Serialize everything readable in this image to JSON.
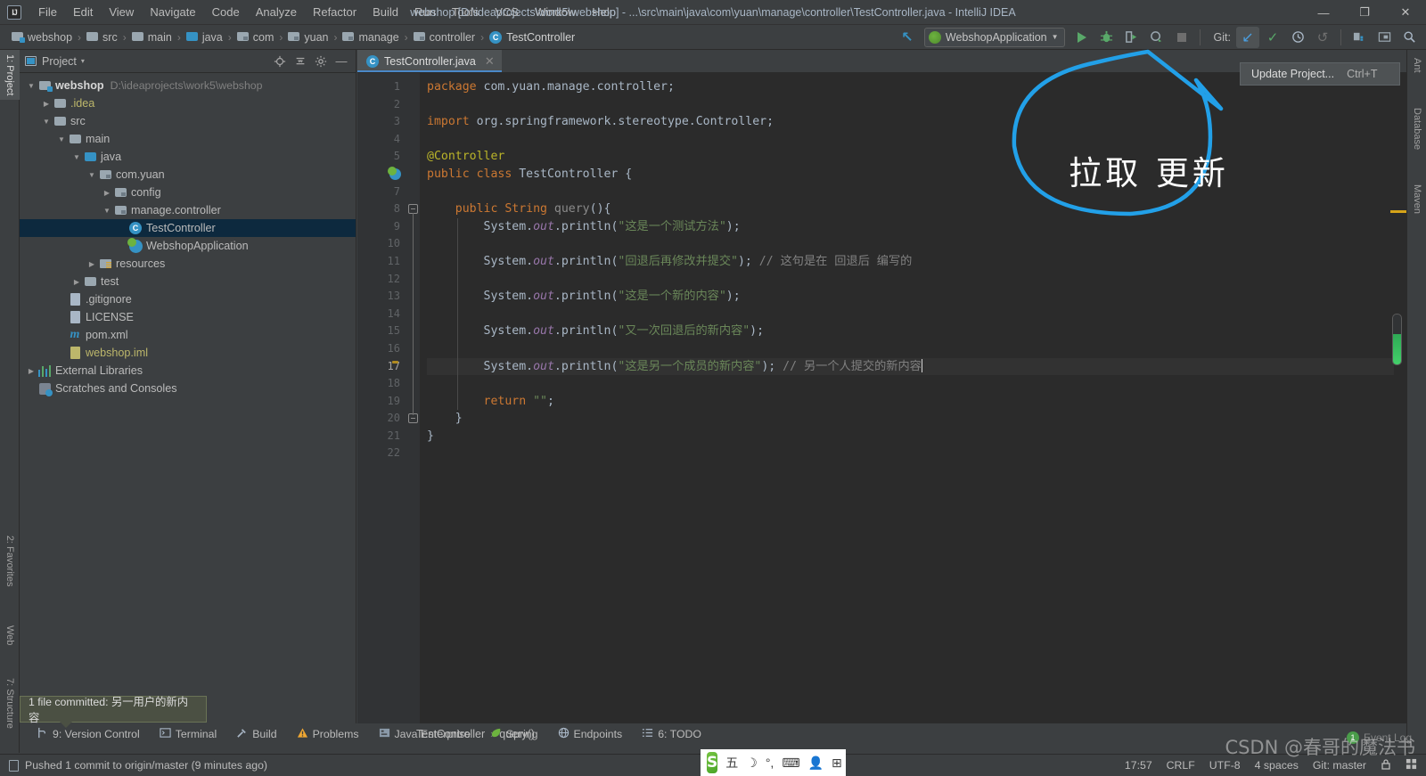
{
  "window": {
    "title": "webshop [D:\\ideaprojects\\work5\\webshop] - ...\\src\\main\\java\\com\\yuan\\manage\\controller\\TestController.java - IntelliJ IDEA",
    "minimize": "—",
    "maximize": "❐",
    "close": "✕"
  },
  "menu": [
    {
      "label": "File"
    },
    {
      "label": "Edit"
    },
    {
      "label": "View"
    },
    {
      "label": "Navigate"
    },
    {
      "label": "Code"
    },
    {
      "label": "Analyze"
    },
    {
      "label": "Refactor"
    },
    {
      "label": "Build"
    },
    {
      "label": "Run"
    },
    {
      "label": "Tools"
    },
    {
      "label": "VCS"
    },
    {
      "label": "Window"
    },
    {
      "label": "Help"
    }
  ],
  "breadcrumbs": [
    {
      "label": "webshop",
      "icon": "project-folder-icon"
    },
    {
      "label": "src",
      "icon": "folder-icon"
    },
    {
      "label": "main",
      "icon": "folder-icon"
    },
    {
      "label": "java",
      "icon": "source-folder-icon"
    },
    {
      "label": "com",
      "icon": "package-icon"
    },
    {
      "label": "yuan",
      "icon": "package-icon"
    },
    {
      "label": "manage",
      "icon": "package-icon"
    },
    {
      "label": "controller",
      "icon": "package-icon"
    },
    {
      "label": "TestController",
      "icon": "class-icon"
    }
  ],
  "toolbar": {
    "update_project_icon": "update-project-icon",
    "run_configuration": "WebshopApplication",
    "run_icon": "run-icon",
    "debug_icon": "debug-icon",
    "run_coverage_icon": "run-with-coverage-icon",
    "profiler_icon": "profiler-icon",
    "stop_icon": "stop-icon",
    "git_label": "Git:",
    "git_update_icon": "git-update-icon",
    "git_commit_icon": "git-commit-icon",
    "git_history_icon": "git-history-icon",
    "git_rollback_icon": "git-rollback-icon",
    "project_structure_icon": "project-structure-icon",
    "open_in_terminal_icon": "open-in-terminal-icon",
    "search_icon": "search-everywhere-icon"
  },
  "update_tooltip": {
    "label": "Update Project...",
    "shortcut": "Ctrl+T"
  },
  "callout": {
    "text": "拉取 更新",
    "color": "#22a0e8"
  },
  "left_tool_strip": [
    {
      "label": "1: Project",
      "active": true
    },
    {
      "label": "2: Favorites",
      "active": false
    },
    {
      "label": "Web",
      "active": false
    },
    {
      "label": "7: Structure",
      "active": false
    }
  ],
  "right_tool_strip": [
    {
      "label": "Ant"
    },
    {
      "label": "Database"
    },
    {
      "label": "Maven"
    }
  ],
  "project_panel": {
    "title": "Project",
    "caret": "▾",
    "actions": [
      "locate-icon",
      "collapse-all-icon",
      "settings-gear-icon",
      "hide-icon"
    ],
    "tree": [
      {
        "indent": 0,
        "arrow": "▼",
        "icon": "project-folder-icon",
        "label": "webshop",
        "bold": true,
        "path": "D:\\ideaprojects\\work5\\webshop",
        "selected": false
      },
      {
        "indent": 1,
        "arrow": "▶",
        "icon": "folder-icon",
        "label": ".idea",
        "yellow": true,
        "selected": false
      },
      {
        "indent": 1,
        "arrow": "▼",
        "icon": "folder-icon",
        "label": "src",
        "selected": false
      },
      {
        "indent": 2,
        "arrow": "▼",
        "icon": "folder-icon",
        "label": "main",
        "selected": false
      },
      {
        "indent": 3,
        "arrow": "▼",
        "icon": "source-folder-icon",
        "label": "java",
        "selected": false
      },
      {
        "indent": 4,
        "arrow": "▼",
        "icon": "package-icon",
        "label": "com.yuan",
        "selected": false
      },
      {
        "indent": 5,
        "arrow": "▶",
        "icon": "package-icon",
        "label": "config",
        "selected": false
      },
      {
        "indent": 5,
        "arrow": "▼",
        "icon": "package-icon",
        "label": "manage.controller",
        "selected": false
      },
      {
        "indent": 6,
        "arrow": "",
        "icon": "class-icon",
        "label": "TestController",
        "selected": true
      },
      {
        "indent": 6,
        "arrow": "",
        "icon": "spring-class-icon",
        "label": "WebshopApplication",
        "selected": false
      },
      {
        "indent": 4,
        "arrow": "▶",
        "icon": "resources-folder-icon",
        "label": "resources",
        "selected": false
      },
      {
        "indent": 3,
        "arrow": "▶",
        "icon": "folder-icon",
        "label": "test",
        "selected": false
      },
      {
        "indent": 2,
        "arrow": "",
        "icon": "gitignore-file-icon",
        "label": ".gitignore",
        "selected": false
      },
      {
        "indent": 2,
        "arrow": "",
        "icon": "text-file-icon",
        "label": "LICENSE",
        "selected": false
      },
      {
        "indent": 2,
        "arrow": "",
        "icon": "maven-file-icon",
        "label": "pom.xml",
        "selected": false
      },
      {
        "indent": 2,
        "arrow": "",
        "icon": "iml-file-icon",
        "label": "webshop.iml",
        "yellow": true,
        "selected": false
      },
      {
        "indent": 0,
        "arrow": "▶",
        "icon": "external-libraries-icon",
        "label": "External Libraries",
        "selected": false
      },
      {
        "indent": 0,
        "arrow": "",
        "icon": "scratches-icon",
        "label": "Scratches and Consoles",
        "selected": false
      }
    ]
  },
  "editor": {
    "tab": {
      "label": "TestController.java",
      "icon": "class-icon",
      "close": "✕"
    },
    "first_line": 1,
    "lines": [
      {
        "n": 1,
        "tokens": [
          {
            "t": "package ",
            "c": "kw"
          },
          {
            "t": "com.yuan.manage.controller;",
            "c": "mth"
          }
        ],
        "indent": 0
      },
      {
        "n": 2,
        "tokens": [],
        "indent": 0
      },
      {
        "n": 3,
        "tokens": [
          {
            "t": "import ",
            "c": "kw"
          },
          {
            "t": "org.springframework.stereotype.Controller;",
            "c": "mth"
          }
        ],
        "indent": 0
      },
      {
        "n": 4,
        "tokens": [],
        "indent": 0
      },
      {
        "n": 5,
        "tokens": [
          {
            "t": "@Controller",
            "c": "ann"
          }
        ],
        "indent": 0
      },
      {
        "n": 6,
        "tokens": [
          {
            "t": "public class ",
            "c": "kw"
          },
          {
            "t": "TestController {",
            "c": "cls"
          }
        ],
        "indent": 0,
        "gutter_icon": "spring-bean-icon"
      },
      {
        "n": 7,
        "tokens": [],
        "indent": 0
      },
      {
        "n": 8,
        "tokens": [
          {
            "t": "    ",
            "c": "mth"
          },
          {
            "t": "public String ",
            "c": "kw"
          },
          {
            "t": "query",
            "c": "mdecl"
          },
          {
            "t": "(){",
            "c": "mth"
          }
        ],
        "indent": 0,
        "fold": "open"
      },
      {
        "n": 9,
        "tokens": [
          {
            "t": "        System.",
            "c": "mth"
          },
          {
            "t": "out",
            "c": "fld"
          },
          {
            "t": ".println(",
            "c": "mth"
          },
          {
            "t": "\"这是一个测试方法\"",
            "c": "str"
          },
          {
            "t": ");",
            "c": "mth"
          }
        ],
        "indent": 0
      },
      {
        "n": 10,
        "tokens": [],
        "indent": 0
      },
      {
        "n": 11,
        "tokens": [
          {
            "t": "        System.",
            "c": "mth"
          },
          {
            "t": "out",
            "c": "fld"
          },
          {
            "t": ".println(",
            "c": "mth"
          },
          {
            "t": "\"回退后再修改并提交\"",
            "c": "str"
          },
          {
            "t": "); ",
            "c": "mth"
          },
          {
            "t": "// 这句是在 回退后 编写的",
            "c": "cmt"
          }
        ],
        "indent": 0
      },
      {
        "n": 12,
        "tokens": [],
        "indent": 0
      },
      {
        "n": 13,
        "tokens": [
          {
            "t": "        System.",
            "c": "mth"
          },
          {
            "t": "out",
            "c": "fld"
          },
          {
            "t": ".println(",
            "c": "mth"
          },
          {
            "t": "\"这是一个新的内容\"",
            "c": "str"
          },
          {
            "t": ");",
            "c": "mth"
          }
        ],
        "indent": 0
      },
      {
        "n": 14,
        "tokens": [],
        "indent": 0
      },
      {
        "n": 15,
        "tokens": [
          {
            "t": "        System.",
            "c": "mth"
          },
          {
            "t": "out",
            "c": "fld"
          },
          {
            "t": ".println(",
            "c": "mth"
          },
          {
            "t": "\"又一次回退后的新内容\"",
            "c": "str"
          },
          {
            "t": ");",
            "c": "mth"
          }
        ],
        "indent": 0
      },
      {
        "n": 16,
        "tokens": [],
        "indent": 0
      },
      {
        "n": 17,
        "tokens": [
          {
            "t": "        System.",
            "c": "mth"
          },
          {
            "t": "out",
            "c": "fld"
          },
          {
            "t": ".println(",
            "c": "mth"
          },
          {
            "t": "\"这是另一个成员的新内容\"",
            "c": "str"
          },
          {
            "t": "); ",
            "c": "mth"
          },
          {
            "t": "// 另一个人提交的新内容",
            "c": "cmt"
          }
        ],
        "indent": 0,
        "current": true,
        "gutter_icon": "intention-bulb-icon",
        "caret_end": true
      },
      {
        "n": 18,
        "tokens": [],
        "indent": 0
      },
      {
        "n": 19,
        "tokens": [
          {
            "t": "        ",
            "c": "mth"
          },
          {
            "t": "return ",
            "c": "kw"
          },
          {
            "t": "\"\"",
            "c": "str"
          },
          {
            "t": ";",
            "c": "mth"
          }
        ],
        "indent": 0
      },
      {
        "n": 20,
        "tokens": [
          {
            "t": "    }",
            "c": "mth"
          }
        ],
        "indent": 0,
        "fold": "close"
      },
      {
        "n": 21,
        "tokens": [
          {
            "t": "}",
            "c": "mth"
          }
        ],
        "indent": 0
      },
      {
        "n": 22,
        "tokens": [],
        "indent": 0
      }
    ]
  },
  "editor_breadcrumb": [
    {
      "label": "TestController"
    },
    {
      "label": "query()"
    }
  ],
  "bottom_tabs": [
    {
      "label": "9: Version Control",
      "icon": "version-control-icon"
    },
    {
      "label": "Terminal",
      "icon": "terminal-icon"
    },
    {
      "label": "Build",
      "icon": "build-hammer-icon"
    },
    {
      "label": "Problems",
      "icon": "problems-warning-icon"
    },
    {
      "label": "Java Enterprise",
      "icon": "java-enterprise-icon"
    },
    {
      "label": "Spring",
      "icon": "spring-leaf-icon"
    },
    {
      "label": "Endpoints",
      "icon": "endpoints-globe-icon"
    },
    {
      "label": "6: TODO",
      "icon": "todo-list-icon"
    }
  ],
  "commit_tooltip": {
    "text": "1 file committed: 另一用户的新内容"
  },
  "statusbar": {
    "message": "Pushed 1 commit to origin/master (9 minutes ago)",
    "message_icon": "message-icon",
    "time": "17:57",
    "line_separator": "CRLF",
    "encoding": "UTF-8",
    "indent": "4 spaces",
    "git_branch": "Git: master",
    "lock_icon": "lock-icon",
    "event_log_icon": "event-log-icon"
  },
  "event_log_watermark": {
    "badge": "1",
    "label": "Event Log"
  },
  "ime_bar": {
    "logo": "S",
    "items": [
      "五",
      "☽",
      "°,",
      "⌨",
      "👤",
      "⊞"
    ]
  },
  "watermark": {
    "text": "CSDN @春哥的魔法书"
  }
}
